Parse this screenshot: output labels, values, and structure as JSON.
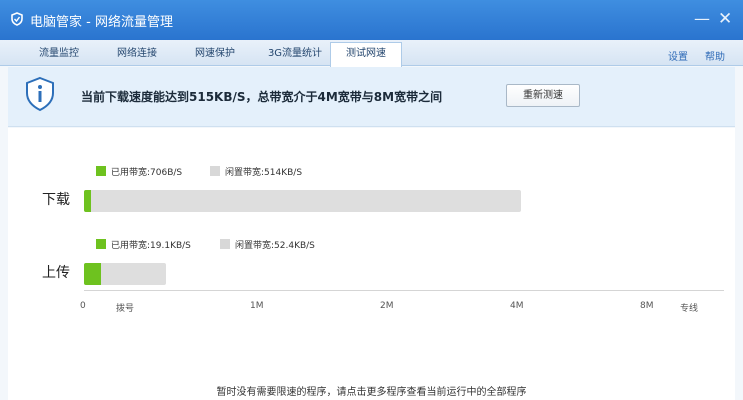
{
  "window": {
    "title": "电脑管家 - 网络流量管理"
  },
  "tabs": [
    {
      "label": "流量监控"
    },
    {
      "label": "网络连接"
    },
    {
      "label": "网速保护"
    },
    {
      "label": "3G流量统计"
    },
    {
      "label": "测试网速",
      "active": true
    }
  ],
  "top_links": {
    "settings": "设置",
    "help": "帮助"
  },
  "banner": {
    "message": "当前下载速度能达到515KB/S，总带宽介于4M宽带与8M宽带之间",
    "retest_label": "重新测速"
  },
  "download": {
    "label": "下载",
    "used_legend": "已用带宽:706B/S",
    "idle_legend": "闲置带宽:514KB/S",
    "used_fraction": 0.016,
    "total_mbps": 4.15
  },
  "upload": {
    "label": "上传",
    "used_legend": "已用带宽:19.1KB/S",
    "idle_legend": "闲置带宽:52.4KB/S",
    "used_fraction": 0.21,
    "total_mbps": 0.48
  },
  "axis_ticks": [
    "0",
    "拨号",
    "1M",
    "2M",
    "4M",
    "8M",
    "专线"
  ],
  "footer": "暂时没有需要限速的程序，请点击更多程序查看当前运行中的全部程序",
  "colors": {
    "used": "#6ec21f",
    "idle": "#d8d8d8",
    "titlebar": "#2a74cf"
  }
}
